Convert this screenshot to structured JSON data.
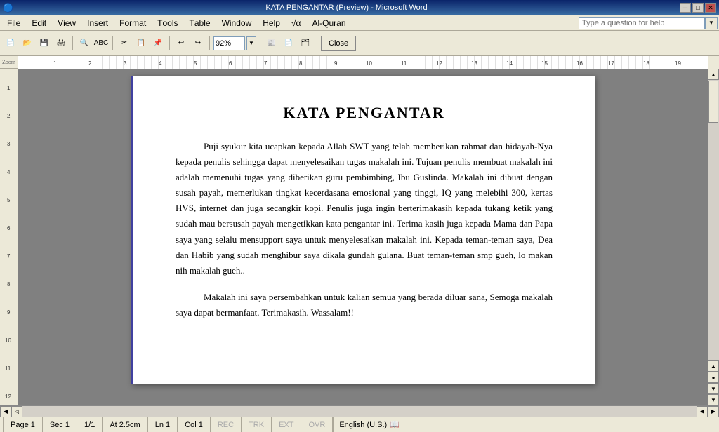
{
  "titlebar": {
    "title": "KATA PENGANTAR (Preview) - Microsoft Word",
    "min_btn": "─",
    "max_btn": "□",
    "close_btn": "✕"
  },
  "menubar": {
    "items": [
      {
        "label": "File",
        "underline": "F"
      },
      {
        "label": "Edit",
        "underline": "E"
      },
      {
        "label": "View",
        "underline": "V"
      },
      {
        "label": "Insert",
        "underline": "I"
      },
      {
        "label": "Format",
        "underline": "o"
      },
      {
        "label": "Tools",
        "underline": "T"
      },
      {
        "label": "Table",
        "underline": "a"
      },
      {
        "label": "Window",
        "underline": "W"
      },
      {
        "label": "Help",
        "underline": "H"
      },
      {
        "label": "√α",
        "underline": ""
      },
      {
        "label": "Al-Quran",
        "underline": ""
      }
    ]
  },
  "toolbar": {
    "zoom_value": "92%",
    "zoom_placeholder": "92%",
    "close_label": "Close",
    "zoom_tooltip": "Zoom"
  },
  "help": {
    "placeholder": "Type a question for help"
  },
  "page": {
    "title": "KATA PENGANTAR",
    "paragraph1": "Puji syukur kita ucapkan kepada Allah SWT yang telah memberikan rahmat dan hidayah-Nya kepada penulis sehingga dapat menyelesaikan tugas makalah ini. Tujuan penulis membuat makalah ini adalah memenuhi tugas yang diberikan guru pembimbing, Ibu Guslinda. Makalah ini dibuat dengan susah payah, memerlukan tingkat kecerdasana emosional yang tinggi, IQ yang melebihi 300, kertas HVS, internet dan juga secangkir kopi. Penulis juga ingin berterimakasih kepada tukang ketik yang sudah mau bersusah payah mengetikkan kata pengantar ini. Terima kasih juga kepada Mama dan Papa saya yang selalu mensupport saya untuk menyelesaikan makalah ini. Kepada teman-teman saya, Dea dan Habib yang sudah menghibur saya dikala gundah gulana. Buat teman-teman smp gueh, lo makan nih makalah gueh..",
    "paragraph2": "Makalah ini saya persembahkan untuk kalian semua yang berada diluar sana, Semoga makalah saya dapat bermanfaat. Terimakasih. Wassalam!!"
  },
  "statusbar": {
    "page": "Page 1",
    "sec": "Sec 1",
    "page_count": "1/1",
    "at": "At 2.5cm",
    "ln": "Ln 1",
    "col": "Col 1",
    "rec": "REC",
    "trk": "TRK",
    "ext": "EXT",
    "ovr": "OVR",
    "language": "English (U.S.)"
  }
}
